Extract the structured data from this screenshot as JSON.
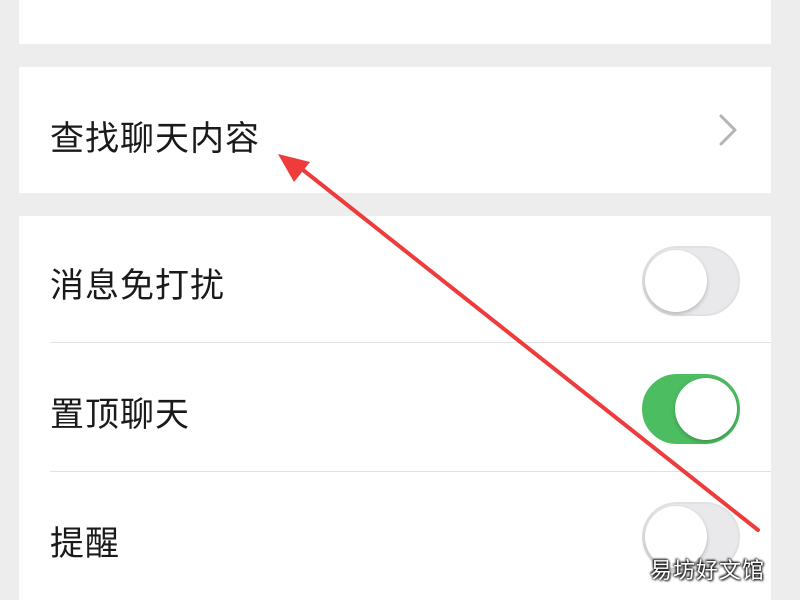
{
  "search_section": {
    "label": "查找聊天内容",
    "trailing_icon": "chevron-right-icon"
  },
  "settings": {
    "mute": {
      "label": "消息免打扰",
      "enabled": false
    },
    "pin": {
      "label": "置顶聊天",
      "enabled": true
    },
    "remind": {
      "label": "提醒",
      "enabled": false
    }
  },
  "colors": {
    "background": "#ededed",
    "card": "#ffffff",
    "toggle_on": "#4cbd60",
    "toggle_off": "#e9e9eb",
    "annotation_arrow": "#ee3b3b"
  },
  "watermark": "易坊好文馆"
}
